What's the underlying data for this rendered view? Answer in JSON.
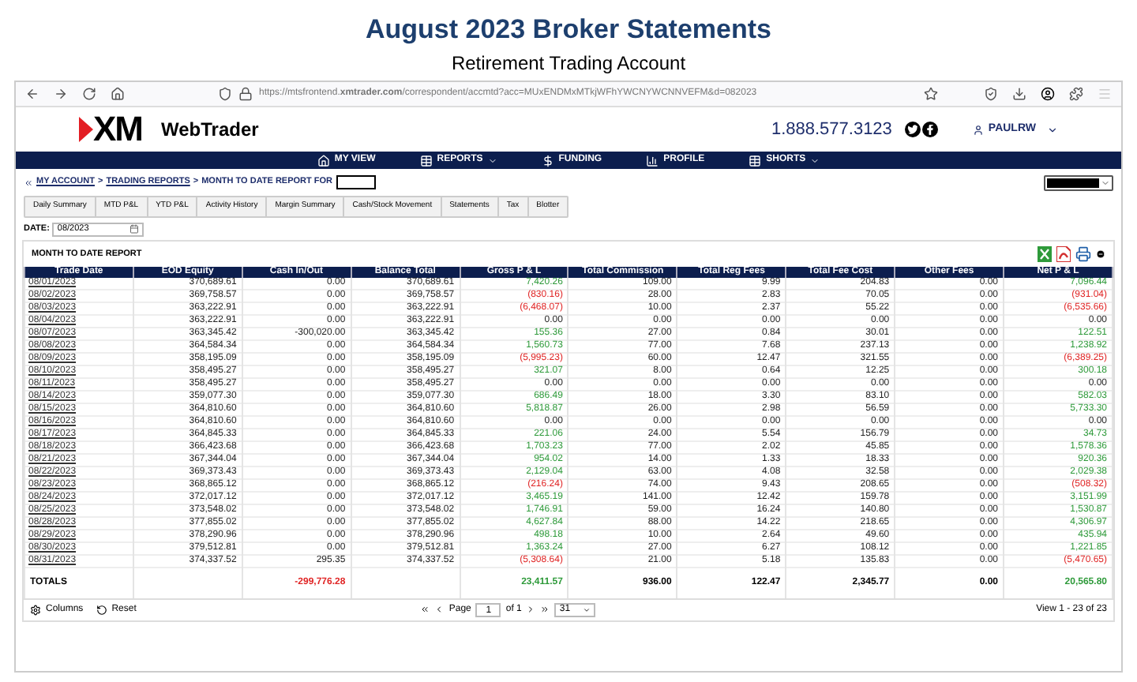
{
  "heading": {
    "title": "August 2023 Broker Statements",
    "subtitle": "Retirement Trading Account"
  },
  "browser": {
    "url": "https://mtsfrontend.**xmtrader.com**/correspondent/accmtd?acc=MUxENDMxMTkjWFhYWCNYWCNNVEFM&d=082023"
  },
  "app": {
    "logo": "XM",
    "name": "WebTrader",
    "phone": "1.888.577.3123",
    "user": "PAULRW"
  },
  "nav": [
    {
      "label": "MY VIEW",
      "dropdown": false
    },
    {
      "label": "REPORTS",
      "dropdown": true
    },
    {
      "label": "FUNDING",
      "dropdown": false
    },
    {
      "label": "PROFILE",
      "dropdown": false
    },
    {
      "label": "SHORTS",
      "dropdown": true
    }
  ],
  "breadcrumb": [
    {
      "label": "MY ACCOUNT",
      "kind": "link"
    },
    {
      "label": ">",
      "kind": "separator"
    },
    {
      "label": "TRADING REPORTS",
      "kind": "link"
    },
    {
      "label": ">",
      "kind": "separator"
    },
    {
      "label": "MONTH TO DATE REPORT FOR",
      "kind": "current"
    }
  ],
  "tabs": [
    {
      "label": "Daily Summary",
      "selected": false
    },
    {
      "label": "MTD P&L",
      "selected": false
    },
    {
      "label": "YTD P&L",
      "selected": false
    },
    {
      "label": "Activity History",
      "selected": false
    },
    {
      "label": "Margin Summary",
      "selected": false
    },
    {
      "label": "Cash/Stock Movement",
      "selected": false
    },
    {
      "label": "Statements",
      "selected": false
    },
    {
      "label": "Tax",
      "selected": false
    },
    {
      "label": "Blotter",
      "selected": false
    }
  ],
  "date": {
    "label": "DATE:",
    "value": "08/2023"
  },
  "report": {
    "title": "MONTH TO DATE REPORT",
    "columns": [
      "Trade Date",
      "EOD Equity",
      "Cash In/Out",
      "Balance Total",
      "Gross P & L",
      "Total Commission",
      "Total Reg Fees",
      "Total Fee Cost",
      "Other Fees",
      "Net P & L"
    ],
    "rows": [
      {
        "date": "08/01/2023",
        "eod": "370,689.61",
        "cash": "0.00",
        "balance": "370,689.61",
        "gross": {
          "text": "7,420.26",
          "color": "#2e9a3a"
        },
        "commission": "109.00",
        "reg_fees": "9.99",
        "fee_cost": "204.83",
        "other_fees": "0.00",
        "net": {
          "text": "7,096.44",
          "color": "#2e9a3a"
        }
      },
      {
        "date": "08/02/2023",
        "eod": "369,758.57",
        "cash": "0.00",
        "balance": "369,758.57",
        "gross": {
          "text": "(830.16)",
          "color": "#e02424"
        },
        "commission": "28.00",
        "reg_fees": "2.83",
        "fee_cost": "70.05",
        "other_fees": "0.00",
        "net": {
          "text": "(931.04)",
          "color": "#e02424"
        }
      },
      {
        "date": "08/03/2023",
        "eod": "363,222.91",
        "cash": "0.00",
        "balance": "363,222.91",
        "gross": {
          "text": "(6,468.07)",
          "color": "#e02424"
        },
        "commission": "10.00",
        "reg_fees": "2.37",
        "fee_cost": "55.22",
        "other_fees": "0.00",
        "net": {
          "text": "(6,535.66)",
          "color": "#e02424"
        }
      },
      {
        "date": "08/04/2023",
        "eod": "363,222.91",
        "cash": "0.00",
        "balance": "363,222.91",
        "gross": "0.00",
        "commission": "0.00",
        "reg_fees": "0.00",
        "fee_cost": "0.00",
        "other_fees": "0.00",
        "net": "0.00"
      },
      {
        "date": "08/07/2023",
        "eod": "363,345.42",
        "cash": "-300,020.00",
        "balance": "363,345.42",
        "gross": {
          "text": "155.36",
          "color": "#2e9a3a"
        },
        "commission": "27.00",
        "reg_fees": "0.84",
        "fee_cost": "30.01",
        "other_fees": "0.00",
        "net": {
          "text": "122.51",
          "color": "#2e9a3a"
        }
      },
      {
        "date": "08/08/2023",
        "eod": "364,584.34",
        "cash": "0.00",
        "balance": "364,584.34",
        "gross": {
          "text": "1,560.73",
          "color": "#2e9a3a"
        },
        "commission": "77.00",
        "reg_fees": "7.68",
        "fee_cost": "237.13",
        "other_fees": "0.00",
        "net": {
          "text": "1,238.92",
          "color": "#2e9a3a"
        }
      },
      {
        "date": "08/09/2023",
        "eod": "358,195.09",
        "cash": "0.00",
        "balance": "358,195.09",
        "gross": {
          "text": "(5,995.23)",
          "color": "#e02424"
        },
        "commission": "60.00",
        "reg_fees": "12.47",
        "fee_cost": "321.55",
        "other_fees": "0.00",
        "net": {
          "text": "(6,389.25)",
          "color": "#e02424"
        }
      },
      {
        "date": "08/10/2023",
        "eod": "358,495.27",
        "cash": "0.00",
        "balance": "358,495.27",
        "gross": {
          "text": "321.07",
          "color": "#2e9a3a"
        },
        "commission": "8.00",
        "reg_fees": "0.64",
        "fee_cost": "12.25",
        "other_fees": "0.00",
        "net": {
          "text": "300.18",
          "color": "#2e9a3a"
        }
      },
      {
        "date": "08/11/2023",
        "eod": "358,495.27",
        "cash": "0.00",
        "balance": "358,495.27",
        "gross": "0.00",
        "commission": "0.00",
        "reg_fees": "0.00",
        "fee_cost": "0.00",
        "other_fees": "0.00",
        "net": "0.00"
      },
      {
        "date": "08/14/2023",
        "eod": "359,077.30",
        "cash": "0.00",
        "balance": "359,077.30",
        "gross": {
          "text": "686.49",
          "color": "#2e9a3a"
        },
        "commission": "18.00",
        "reg_fees": "3.30",
        "fee_cost": "83.10",
        "other_fees": "0.00",
        "net": {
          "text": "582.03",
          "color": "#2e9a3a"
        }
      },
      {
        "date": "08/15/2023",
        "eod": "364,810.60",
        "cash": "0.00",
        "balance": "364,810.60",
        "gross": {
          "text": "5,818.87",
          "color": "#2e9a3a"
        },
        "commission": "26.00",
        "reg_fees": "2.98",
        "fee_cost": "56.59",
        "other_fees": "0.00",
        "net": {
          "text": "5,733.30",
          "color": "#2e9a3a"
        }
      },
      {
        "date": "08/16/2023",
        "eod": "364,810.60",
        "cash": "0.00",
        "balance": "364,810.60",
        "gross": "0.00",
        "commission": "0.00",
        "reg_fees": "0.00",
        "fee_cost": "0.00",
        "other_fees": "0.00",
        "net": "0.00"
      },
      {
        "date": "08/17/2023",
        "eod": "364,845.33",
        "cash": "0.00",
        "balance": "364,845.33",
        "gross": {
          "text": "221.06",
          "color": "#2e9a3a"
        },
        "commission": "24.00",
        "reg_fees": "5.54",
        "fee_cost": "156.79",
        "other_fees": "0.00",
        "net": {
          "text": "34.73",
          "color": "#2e9a3a"
        }
      },
      {
        "date": "08/18/2023",
        "eod": "366,423.68",
        "cash": "0.00",
        "balance": "366,423.68",
        "gross": {
          "text": "1,703.23",
          "color": "#2e9a3a"
        },
        "commission": "77.00",
        "reg_fees": "2.02",
        "fee_cost": "45.85",
        "other_fees": "0.00",
        "net": {
          "text": "1,578.36",
          "color": "#2e9a3a"
        }
      },
      {
        "date": "08/21/2023",
        "eod": "367,344.04",
        "cash": "0.00",
        "balance": "367,344.04",
        "gross": {
          "text": "954.02",
          "color": "#2e9a3a"
        },
        "commission": "14.00",
        "reg_fees": "1.33",
        "fee_cost": "18.33",
        "other_fees": "0.00",
        "net": {
          "text": "920.36",
          "color": "#2e9a3a"
        }
      },
      {
        "date": "08/22/2023",
        "eod": "369,373.43",
        "cash": "0.00",
        "balance": "369,373.43",
        "gross": {
          "text": "2,129.04",
          "color": "#2e9a3a"
        },
        "commission": "63.00",
        "reg_fees": "4.08",
        "fee_cost": "32.58",
        "other_fees": "0.00",
        "net": {
          "text": "2,029.38",
          "color": "#2e9a3a"
        }
      },
      {
        "date": "08/23/2023",
        "eod": "368,865.12",
        "cash": "0.00",
        "balance": "368,865.12",
        "gross": {
          "text": "(216.24)",
          "color": "#e02424"
        },
        "commission": "74.00",
        "reg_fees": "9.43",
        "fee_cost": "208.65",
        "other_fees": "0.00",
        "net": {
          "text": "(508.32)",
          "color": "#e02424"
        }
      },
      {
        "date": "08/24/2023",
        "eod": "372,017.12",
        "cash": "0.00",
        "balance": "372,017.12",
        "gross": {
          "text": "3,465.19",
          "color": "#2e9a3a"
        },
        "commission": "141.00",
        "reg_fees": "12.42",
        "fee_cost": "159.78",
        "other_fees": "0.00",
        "net": {
          "text": "3,151.99",
          "color": "#2e9a3a"
        }
      },
      {
        "date": "08/25/2023",
        "eod": "373,548.02",
        "cash": "0.00",
        "balance": "373,548.02",
        "gross": {
          "text": "1,746.91",
          "color": "#2e9a3a"
        },
        "commission": "59.00",
        "reg_fees": "16.24",
        "fee_cost": "140.80",
        "other_fees": "0.00",
        "net": {
          "text": "1,530.87",
          "color": "#2e9a3a"
        }
      },
      {
        "date": "08/28/2023",
        "eod": "377,855.02",
        "cash": "0.00",
        "balance": "377,855.02",
        "gross": {
          "text": "4,627.84",
          "color": "#2e9a3a"
        },
        "commission": "88.00",
        "reg_fees": "14.22",
        "fee_cost": "218.65",
        "other_fees": "0.00",
        "net": {
          "text": "4,306.97",
          "color": "#2e9a3a"
        }
      },
      {
        "date": "08/29/2023",
        "eod": "378,290.96",
        "cash": "0.00",
        "balance": "378,290.96",
        "gross": {
          "text": "498.18",
          "color": "#2e9a3a"
        },
        "commission": "10.00",
        "reg_fees": "2.64",
        "fee_cost": "49.60",
        "other_fees": "0.00",
        "net": {
          "text": "435.94",
          "color": "#2e9a3a"
        }
      },
      {
        "date": "08/30/2023",
        "eod": "379,512.81",
        "cash": "0.00",
        "balance": "379,512.81",
        "gross": {
          "text": "1,363.24",
          "color": "#2e9a3a"
        },
        "commission": "27.00",
        "reg_fees": "6.27",
        "fee_cost": "108.12",
        "other_fees": "0.00",
        "net": {
          "text": "1,221.85",
          "color": "#2e9a3a"
        }
      },
      {
        "date": "08/31/2023",
        "eod": "374,337.52",
        "cash": "295.35",
        "balance": "374,337.52",
        "gross": {
          "text": "(5,308.64)",
          "color": "#e02424"
        },
        "commission": "21.00",
        "reg_fees": "5.18",
        "fee_cost": "135.83",
        "other_fees": "0.00",
        "net": {
          "text": "(5,470.65)",
          "color": "#e02424"
        }
      }
    ],
    "totals": {
      "label": "TOTALS",
      "cash": {
        "text": "-299,776.28",
        "color": "#e02424"
      },
      "gross": {
        "text": "23,411.57",
        "color": "#2e9a3a"
      },
      "commission": "936.00",
      "reg_fees": "122.47",
      "fee_cost": "2,345.77",
      "other_fees": "0.00",
      "net": {
        "text": "20,565.80",
        "color": "#2e9a3a"
      }
    }
  },
  "pager": {
    "columns": "Columns",
    "reset": "Reset",
    "page_label": "Page",
    "page": "1",
    "of": "of 1",
    "page_size": "31",
    "view": "View 1 - 23 of 23"
  }
}
